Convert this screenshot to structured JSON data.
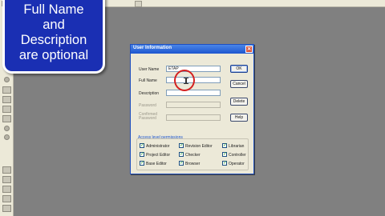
{
  "callout": {
    "lines": [
      "Full Name",
      "and",
      "Description",
      "are optional"
    ]
  },
  "dialog": {
    "title": "User Information",
    "fields": [
      {
        "label": "User Name",
        "value": "ETAP",
        "enabled": true
      },
      {
        "label": "Full Name",
        "value": "",
        "enabled": true
      },
      {
        "label": "Description",
        "value": "",
        "enabled": true
      },
      {
        "label": "Password",
        "value": "",
        "enabled": false
      },
      {
        "label": "Confirmed Password",
        "value": "",
        "enabled": false
      }
    ],
    "buttons": {
      "ok": "OK",
      "cancel": "Cancel",
      "delete": "Delete",
      "help": "Help"
    },
    "permissions_title": "Access level permissions",
    "permissions": [
      {
        "label": "Administrator",
        "checked": true
      },
      {
        "label": "Revision Editor",
        "checked": true
      },
      {
        "label": "Librarian",
        "checked": true
      },
      {
        "label": "Project Editor",
        "checked": true
      },
      {
        "label": "Checker",
        "checked": true
      },
      {
        "label": "Controller",
        "checked": true
      },
      {
        "label": "Base Editor",
        "checked": true
      },
      {
        "label": "Browser",
        "checked": true
      },
      {
        "label": "Operator",
        "checked": true
      }
    ]
  },
  "colors": {
    "callout_bg": "#1a2fb3",
    "titlebar": "#1d56cf",
    "highlight_ring": "#d42020"
  }
}
